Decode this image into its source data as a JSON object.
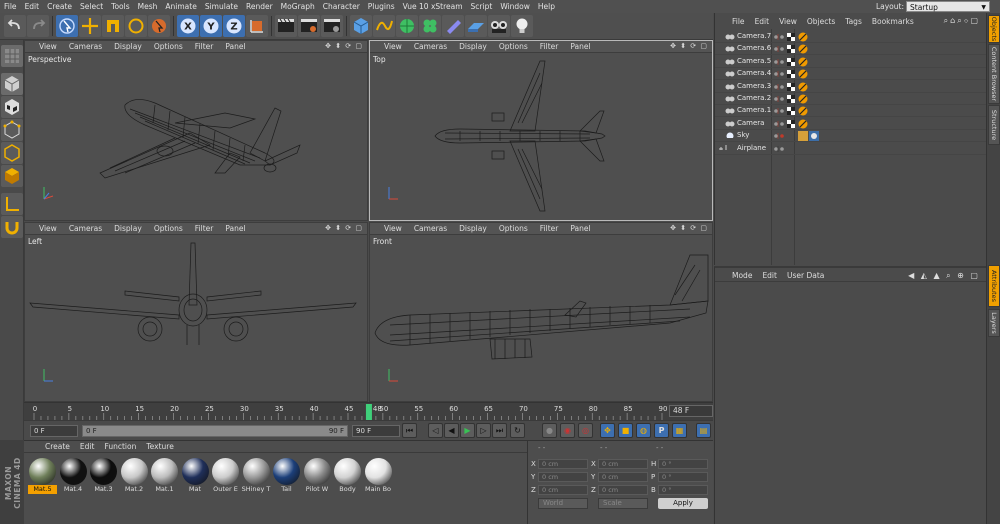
{
  "menubar": [
    "File",
    "Edit",
    "Create",
    "Select",
    "Tools",
    "Mesh",
    "Animate",
    "Simulate",
    "Render",
    "MoGraph",
    "Character",
    "Plugins",
    "Vue 10 xStream",
    "Script",
    "Window",
    "Help"
  ],
  "layout": {
    "label": "Layout:",
    "value": "Startup"
  },
  "viewport_menu": [
    "View",
    "Cameras",
    "Display",
    "Options",
    "Filter",
    "Panel"
  ],
  "viewports": {
    "perspective": "Perspective",
    "top": "Top",
    "left": "Left",
    "front": "Front"
  },
  "timeline": {
    "ticks": [
      "0",
      "5",
      "10",
      "15",
      "20",
      "25",
      "30",
      "35",
      "40",
      "45",
      "50",
      "55",
      "60",
      "65",
      "70",
      "75",
      "80",
      "85",
      "90"
    ],
    "current": "48",
    "frame_field": "48 F"
  },
  "controls": {
    "start": "0 F",
    "range_start": "0 F",
    "range_end": "90 F",
    "end": "90 F"
  },
  "material_menu": [
    "Create",
    "Edit",
    "Function",
    "Texture"
  ],
  "materials": [
    {
      "name": "Mat.5",
      "color": "#6f7f5a",
      "selected": true
    },
    {
      "name": "Mat.4",
      "color": "#111111",
      "selected": false
    },
    {
      "name": "Mat.3",
      "color": "#0d0d0d",
      "selected": false
    },
    {
      "name": "Mat.2",
      "color": "#c8c8c8",
      "selected": false
    },
    {
      "name": "Mat.1",
      "color": "#bdbdbd",
      "selected": false
    },
    {
      "name": "Mat",
      "color": "#1f2f5a",
      "selected": false
    },
    {
      "name": "Outer E",
      "color": "#cccccc",
      "selected": false
    },
    {
      "name": "SHiney T",
      "color": "#9a9a9a",
      "selected": false
    },
    {
      "name": "Tail",
      "color": "#1c3f7a",
      "selected": false
    },
    {
      "name": "Pilot W",
      "color": "#8a8a8a",
      "selected": false
    },
    {
      "name": "Body",
      "color": "#d2d2d2",
      "selected": false
    },
    {
      "name": "Main Bo",
      "color": "#e2e2e2",
      "selected": false
    }
  ],
  "maxon": "MAXON CINEMA 4D",
  "coords": {
    "rows": [
      {
        "a": "X",
        "av": "0 cm",
        "b": "X",
        "bv": "0 cm",
        "c": "H",
        "cv": "0 °"
      },
      {
        "a": "Y",
        "av": "0 cm",
        "b": "Y",
        "bv": "0 cm",
        "c": "P",
        "cv": "0 °"
      },
      {
        "a": "Z",
        "av": "0 cm",
        "b": "Z",
        "bv": "0 cm",
        "c": "B",
        "cv": "0 °"
      }
    ],
    "world": "World",
    "scale": "Scale",
    "apply": "Apply"
  },
  "object_menu": [
    "File",
    "Edit",
    "View",
    "Objects",
    "Tags",
    "Bookmarks"
  ],
  "objects": [
    {
      "name": "Camera.7",
      "kind": "camera"
    },
    {
      "name": "Camera.6",
      "kind": "camera"
    },
    {
      "name": "Camera.5",
      "kind": "camera"
    },
    {
      "name": "Camera.4",
      "kind": "camera"
    },
    {
      "name": "Camera.3",
      "kind": "camera"
    },
    {
      "name": "Camera.2",
      "kind": "camera"
    },
    {
      "name": "Camera.1",
      "kind": "camera"
    },
    {
      "name": "Camera",
      "kind": "camera"
    },
    {
      "name": "Sky",
      "kind": "sky"
    },
    {
      "name": "Airplane",
      "kind": "null"
    }
  ],
  "attr_menu": [
    "Mode",
    "Edit",
    "User Data"
  ],
  "right_tabs": [
    {
      "label": "Objects",
      "on": true
    },
    {
      "label": "Content Browser",
      "on": false
    },
    {
      "label": "Structure",
      "on": false
    },
    {
      "label": "Attributes",
      "on": true
    },
    {
      "label": "Layers",
      "on": false
    }
  ],
  "colors": {
    "accent": "#f4a000",
    "bg": "#4b4b4b",
    "panel": "#4f4f4f"
  }
}
